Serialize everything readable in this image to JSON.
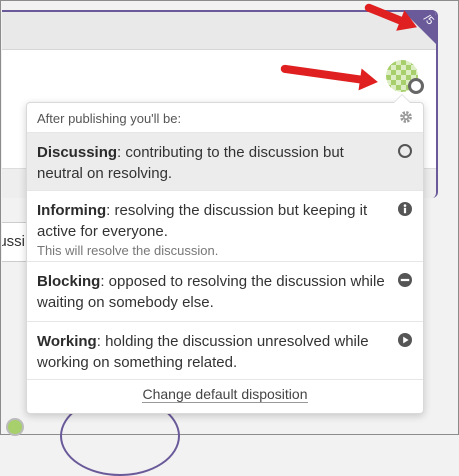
{
  "corner_label": "/5",
  "input_fragment_text": "ussi",
  "dropdown": {
    "header": "After publishing you'll be:",
    "options": [
      {
        "name": "Discussing",
        "desc": ": contributing to the discussion but neutral on resolving.",
        "note": "",
        "icon": "circle-outline-icon"
      },
      {
        "name": "Informing",
        "desc": ": resolving the discussion but keeping it active for everyone.",
        "note": "This will resolve the discussion.",
        "icon": "info-icon"
      },
      {
        "name": "Blocking",
        "desc": ": opposed to resolving the discussion while waiting on somebody else.",
        "note": "",
        "icon": "minus-circle-icon"
      },
      {
        "name": "Working",
        "desc": ": holding the discussion unresolved while working on something related.",
        "note": "",
        "icon": "play-circle-icon"
      }
    ],
    "footer_link": "Change default disposition"
  },
  "colors": {
    "accent": "#6a5a9a",
    "arrow": "#e02020",
    "avatar_green": "#a7cf6b",
    "selected_row": "#ececec"
  }
}
